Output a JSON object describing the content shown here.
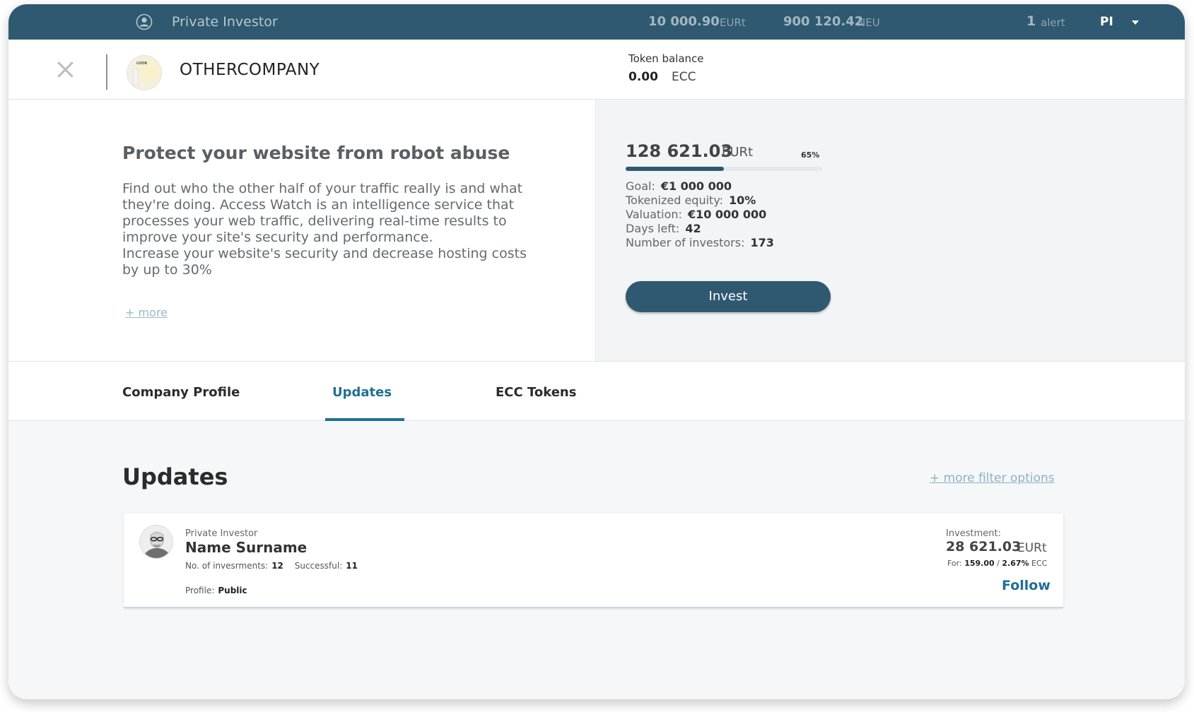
{
  "topbar": {
    "role": "Private Investor",
    "balance_eur": "10 000.90",
    "balance_eur_unit": "EURt",
    "balance_neu": "900 120.42",
    "balance_neu_unit": "NEU",
    "alert_count": "1",
    "alert_label": "alert",
    "user_initials": "PI",
    "icons": [
      "user-circle-icon",
      "caret-down-icon"
    ]
  },
  "company": {
    "name": "OTHERCOMPANY",
    "logo_text": "LOOK",
    "token_balance_label": "Token balance",
    "token_balance_value": "0.00",
    "token_balance_unit": "ECC"
  },
  "pitch": {
    "title": "Protect your website from robot abuse",
    "description": "Find out who the other half of your traffic really is and what\nthey're doing. Access Watch is an intelligence service that\nprocesses your web traffic, delivering real-time results to\nimprove your site's security and performance.\nIncrease your website's security and decrease hosting costs\nby up to 30%",
    "more_label": "+ more"
  },
  "funding": {
    "raised": "128 621.03",
    "raised_unit": "EURt",
    "percent_label": "65%",
    "progress_fraction": 0.5,
    "stats": [
      {
        "label": "Goal:",
        "value": "€1 000 000"
      },
      {
        "label": "Tokenized equity:",
        "value": "10%"
      },
      {
        "label": "Valuation:",
        "value": "€10 000 000"
      },
      {
        "label": "Days left:",
        "value": "42"
      },
      {
        "label": "Number of investors:",
        "value": "173"
      }
    ],
    "invest_label": "Invest"
  },
  "tabs": [
    {
      "label": "Company Profile",
      "active": false
    },
    {
      "label": "Updates",
      "active": true
    },
    {
      "label": "ECC Tokens",
      "active": false
    }
  ],
  "updates": {
    "title": "Updates",
    "filter_label": "+ more filter options",
    "items": [
      {
        "role": "Private Investor",
        "name": "Name Surname",
        "investments_label": "No. of invesrments:",
        "investments_value": "12",
        "successful_label": "Successful:",
        "successful_value": "11",
        "profile_label": "Profile:",
        "profile_value": "Public",
        "investment_label": "Investment:",
        "investment_amount": "28 621.03",
        "investment_unit": "EURt",
        "for_label": "For:",
        "for_tokens": "159.00",
        "for_sep": "/",
        "for_percent": "2.67%",
        "for_unit": "ECC",
        "follow_label": "Follow"
      }
    ]
  },
  "colors": {
    "primary": "#2f5970",
    "accent": "#226e94",
    "link": "#9ab8c8"
  }
}
